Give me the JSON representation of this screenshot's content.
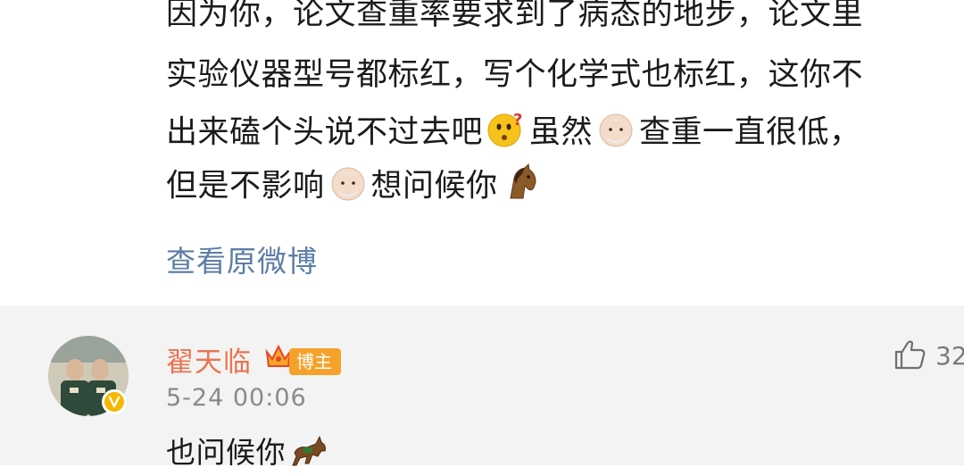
{
  "post": {
    "lines": [
      "因为你，论文查重率要求到了病态的地步，论文里",
      "实验仪器型号都标红，写个化学式也标红，这你不"
    ],
    "line3_part1": "出来磕个头说不过去吧",
    "line3_part2": "虽然",
    "line3_part3": "查重一直很低，",
    "line4_part1": "但是不影响",
    "line4_part2": "想问候你",
    "view_original": "查看原微博",
    "emoji_icons": [
      "thinking-face-icon",
      "old-man-face-icon",
      "horse-face-icon"
    ]
  },
  "comment": {
    "username": "翟天临",
    "host_badge": "博主",
    "timestamp": "5-24 00:06",
    "reply_text": "也问候你",
    "like_count": "32",
    "icons": [
      "avatar",
      "verified-badge-icon",
      "crown-icon",
      "thumbs-up-icon",
      "horse-icon"
    ]
  },
  "colors": {
    "username": "#eb7350",
    "link": "#5d7ea6",
    "comment_background": "#f3f3f3",
    "host_badge": "#f6a12a"
  }
}
